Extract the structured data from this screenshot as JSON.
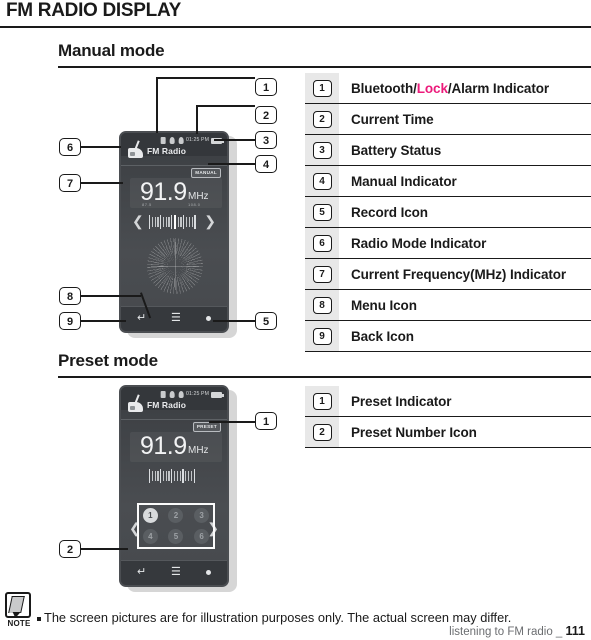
{
  "page": {
    "title": "FM RADIO DISPLAY",
    "footer_text": "listening to FM radio _",
    "page_number": "111"
  },
  "manual_section": {
    "heading": "Manual mode",
    "device": {
      "status_time": "01:25 PM",
      "app_name": "FM Radio",
      "mode_badge": "MANUAL",
      "frequency": "91.9",
      "frequency_unit": "MHz",
      "frequency_scale_left": "87.5",
      "frequency_scale_mid": "",
      "frequency_scale_right": "108.0",
      "nav_back_icon": "back-arrow-icon",
      "nav_menu_icon": "menu-icon",
      "nav_record_icon": "record-icon"
    },
    "callouts": [
      "1",
      "2",
      "3",
      "4",
      "5",
      "6",
      "7",
      "8",
      "9"
    ],
    "legend": [
      {
        "num": "1",
        "pre": "Bluetooth/",
        "hl": "Lock",
        "post": "/Alarm Indicator"
      },
      {
        "num": "2",
        "pre": "Current Time",
        "hl": "",
        "post": ""
      },
      {
        "num": "3",
        "pre": "Battery Status",
        "hl": "",
        "post": ""
      },
      {
        "num": "4",
        "pre": "Manual Indicator",
        "hl": "",
        "post": ""
      },
      {
        "num": "5",
        "pre": "Record Icon",
        "hl": "",
        "post": ""
      },
      {
        "num": "6",
        "pre": "Radio Mode Indicator",
        "hl": "",
        "post": ""
      },
      {
        "num": "7",
        "pre": "Current Frequency(MHz) Indicator",
        "hl": "",
        "post": ""
      },
      {
        "num": "8",
        "pre": "Menu Icon",
        "hl": "",
        "post": ""
      },
      {
        "num": "9",
        "pre": "Back Icon",
        "hl": "",
        "post": ""
      }
    ]
  },
  "preset_section": {
    "heading": "Preset mode",
    "device": {
      "status_time": "01:25 PM",
      "app_name": "FM Radio",
      "mode_badge": "PRESET",
      "frequency": "91.9",
      "frequency_unit": "MHz",
      "presets": [
        "1",
        "2",
        "3",
        "4",
        "5",
        "6"
      ],
      "active_preset": "1",
      "nav_back_icon": "back-arrow-icon",
      "nav_menu_icon": "menu-icon",
      "nav_record_icon": "record-icon"
    },
    "callouts": [
      "1",
      "2"
    ],
    "legend": [
      {
        "num": "1",
        "pre": "Preset Indicator",
        "hl": "",
        "post": ""
      },
      {
        "num": "2",
        "pre": "Preset Number Icon",
        "hl": "",
        "post": ""
      }
    ]
  },
  "note": {
    "label": "NOTE",
    "text": "The screen pictures are for illustration purposes only. The actual screen may differ."
  },
  "colors": {
    "accent": "#ec1b7b",
    "ink": "#1a1a1a",
    "legend_numcell_bg": "#e8e8e8"
  }
}
